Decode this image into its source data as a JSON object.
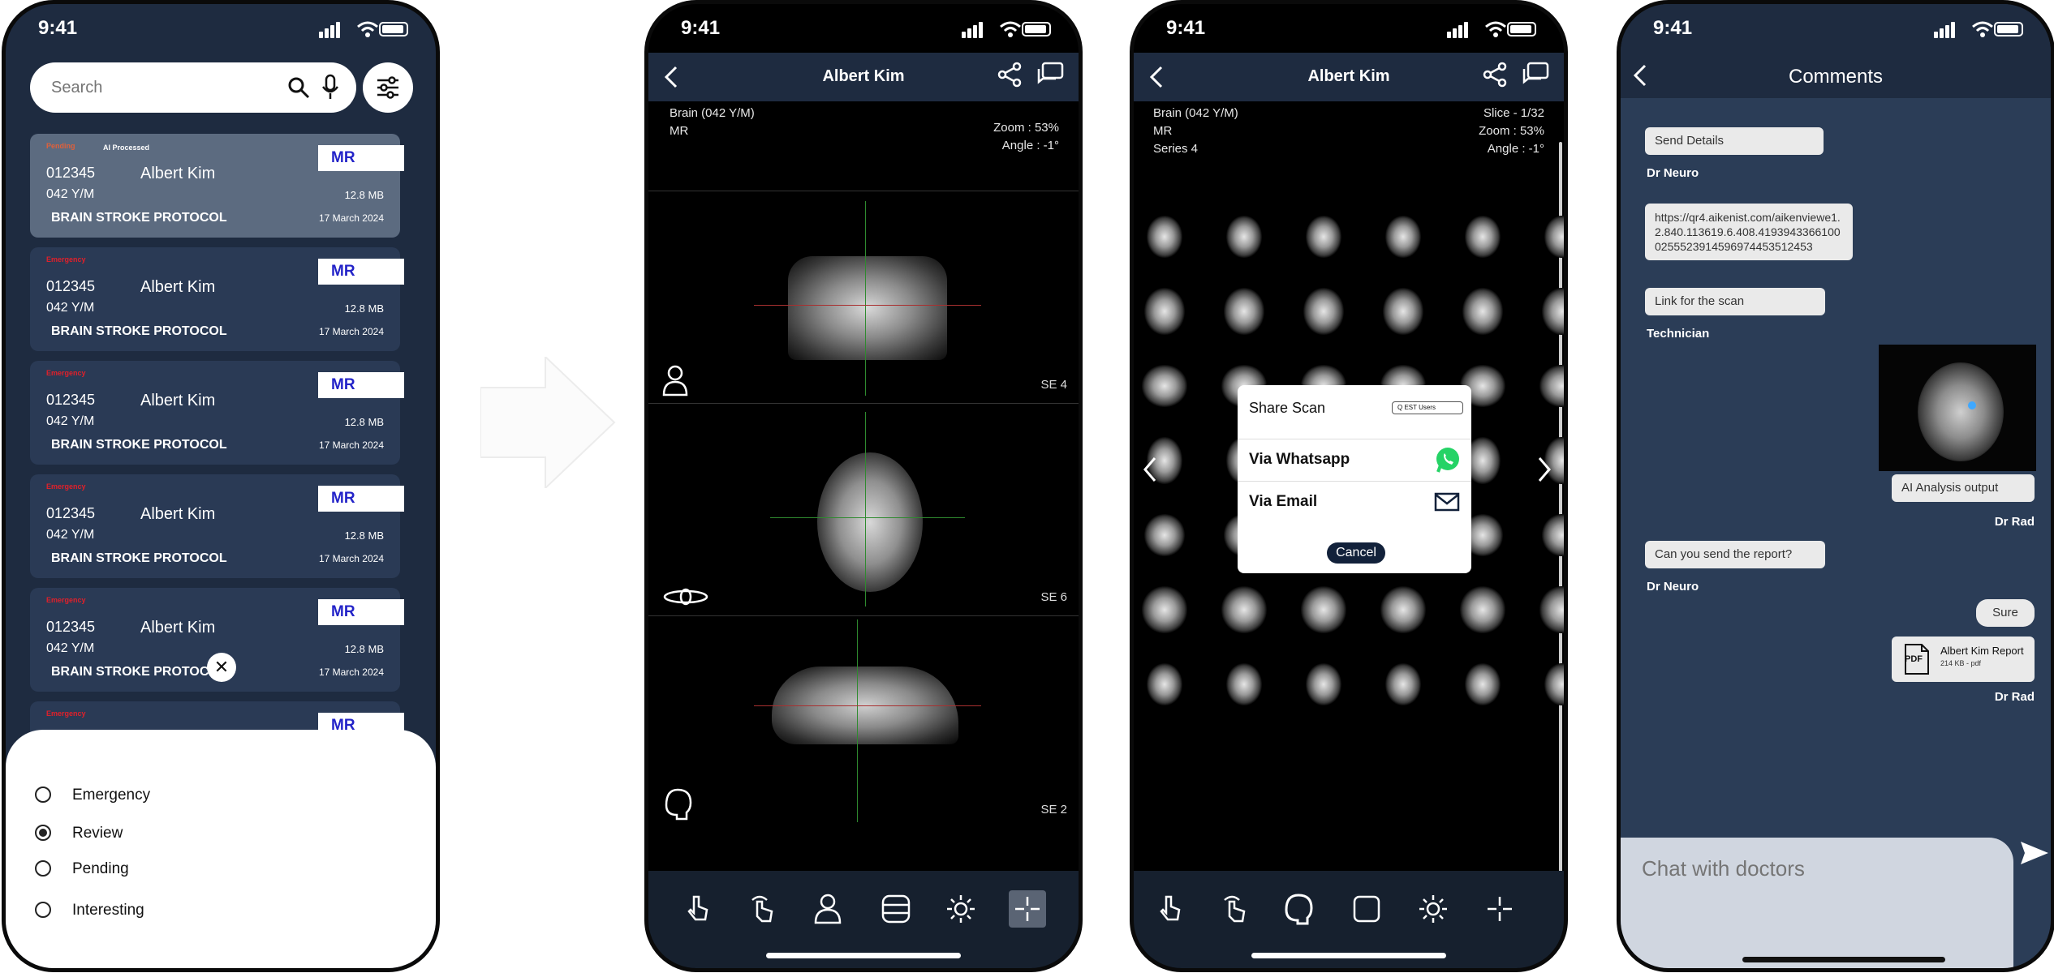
{
  "status_time": "9:41",
  "list_screen": {
    "search_placeholder": "Search",
    "cards": [
      {
        "tag": "Pending",
        "ai": "AI Processed",
        "id": "012345",
        "name": "Albert Kim",
        "modality": "MR",
        "age": "042 Y/M",
        "size": "12.8 MB",
        "protocol": "BRAIN STROKE PROTOCOL",
        "date": "17 March 2024"
      },
      {
        "tag": "Emergency",
        "ai": "",
        "id": "012345",
        "name": "Albert Kim",
        "modality": "MR",
        "age": "042 Y/M",
        "size": "12.8 MB",
        "protocol": "BRAIN STROKE PROTOCOL",
        "date": "17 March 2024"
      },
      {
        "tag": "Emergency",
        "ai": "",
        "id": "012345",
        "name": "Albert Kim",
        "modality": "MR",
        "age": "042 Y/M",
        "size": "12.8 MB",
        "protocol": "BRAIN STROKE PROTOCOL",
        "date": "17 March 2024"
      },
      {
        "tag": "Emergency",
        "ai": "",
        "id": "012345",
        "name": "Albert Kim",
        "modality": "MR",
        "age": "042 Y/M",
        "size": "12.8 MB",
        "protocol": "BRAIN STROKE PROTOCOL",
        "date": "17 March 2024"
      },
      {
        "tag": "Emergency",
        "ai": "",
        "id": "012345",
        "name": "Albert Kim",
        "modality": "MR",
        "age": "042 Y/M",
        "size": "12.8 MB",
        "protocol": "BRAIN STROKE PROTOCOL",
        "date": "17 March 2024"
      },
      {
        "tag": "Emergency",
        "ai": "",
        "id": "",
        "name": "",
        "modality": "MR",
        "age": "",
        "size": "",
        "protocol": "",
        "date": ""
      }
    ],
    "close_symbol": "✕",
    "filter_options": [
      {
        "label": "Emergency",
        "selected": false
      },
      {
        "label": "Review",
        "selected": true
      },
      {
        "label": "Pending",
        "selected": false
      },
      {
        "label": "Interesting",
        "selected": false
      }
    ]
  },
  "viewer_screen": {
    "title": "Albert Kim",
    "info_left": [
      "Brain (042 Y/M)",
      "MR"
    ],
    "info_right": [
      "Zoom : 53%",
      "Angle : -1°"
    ],
    "panes": [
      {
        "series": "SE 4",
        "icon": "person-icon"
      },
      {
        "series": "SE 6",
        "icon": "axial-icon"
      },
      {
        "series": "SE 2",
        "icon": "head-icon"
      }
    ]
  },
  "grid_screen": {
    "title": "Albert Kim",
    "info_left": [
      "Brain (042 Y/M)",
      "MR",
      "Series 4"
    ],
    "info_right": [
      "Slice - 1/32",
      "Zoom : 53%",
      "Angle : -1°"
    ],
    "share": {
      "title": "Share Scan",
      "dropdown": "Q EST Users",
      "whatsapp": "Via Whatsapp",
      "email": "Via Email",
      "cancel": "Cancel"
    }
  },
  "comments_screen": {
    "title": "Comments",
    "messages": [
      {
        "text": "Send Details",
        "sender": "Dr Neuro"
      },
      {
        "text": "https://qr4.aikenist.com/aikenviewe1.2.840.113619.6.408.41939433661000255523914596974453512453",
        "sender": ""
      },
      {
        "text": "Link for the scan",
        "sender": "Technician"
      },
      {
        "text": "AI Analysis output",
        "sender": "Dr Rad"
      },
      {
        "text": "Can you send the report?",
        "sender": "Dr Neuro"
      },
      {
        "text": "Sure",
        "sender": ""
      }
    ],
    "pdf": {
      "name": "Albert Kim Report",
      "meta": "214 KB - pdf",
      "badge": "PDF",
      "sender": "Dr Rad"
    },
    "chat_placeholder": "Chat with doctors"
  },
  "colors": {
    "navy": "#1e2b40",
    "card": "#2a3a55",
    "pending": "#e0603a",
    "emergency": "#e0202a",
    "modality_text": "#2323c8",
    "whatsapp": "#25d366"
  }
}
